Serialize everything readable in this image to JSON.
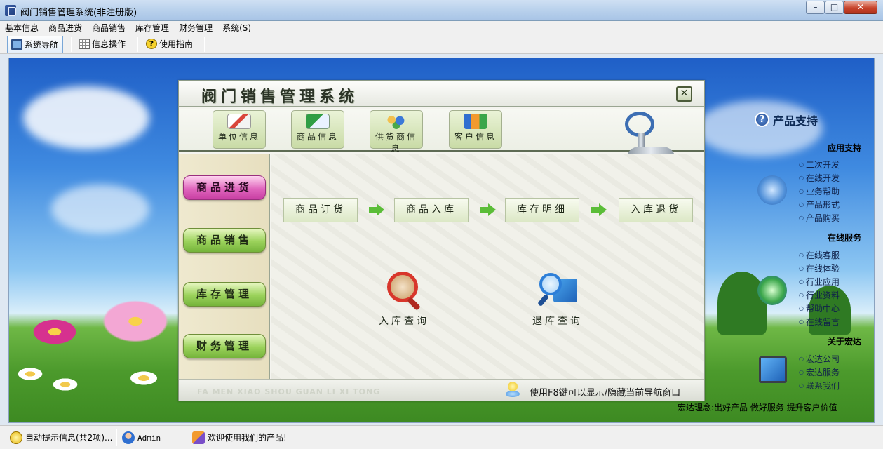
{
  "window": {
    "title": "阀门销售管理系统(非注册版)"
  },
  "menu": [
    "基本信息",
    "商品进货",
    "商品销售",
    "库存管理",
    "财务管理",
    "系统(S)"
  ],
  "toolbar": {
    "nav": "系统导航",
    "info": "信息操作",
    "guide": "使用指南"
  },
  "navigator": {
    "title": "阀门销售管理系统",
    "close": "✕",
    "tools": [
      "单位信息",
      "商品信息",
      "供货商信息",
      "客户信息"
    ],
    "side": [
      "商品进货",
      "商品销售",
      "库存管理",
      "财务管理"
    ],
    "active_side": "商品进货",
    "flow": [
      "商品订货",
      "商品入库",
      "库存明细",
      "入库退货"
    ],
    "queries": [
      "入库查询",
      "退库查询"
    ],
    "footer_pinyin": "FA MEN XIAO SHOU GUAN LI XI TONG",
    "footer_tip": "使用F8键可以显示/隐藏当前导航窗口"
  },
  "support": {
    "title": "产品支持",
    "sections": [
      {
        "name": "应用支持",
        "links": [
          "二次开发",
          "在线开发",
          "业务帮助",
          "产品形式",
          "产品购买"
        ]
      },
      {
        "name": "在线服务",
        "links": [
          "在线客服",
          "在线体验",
          "行业应用",
          "行业资料",
          "帮助中心",
          "在线留言"
        ]
      },
      {
        "name": "关于宏达",
        "links": [
          "宏达公司",
          "宏达服务",
          "联系我们"
        ]
      }
    ],
    "slogan": "宏达理念:出好产品 做好服务 提升客户价值"
  },
  "status": {
    "hint": "自动提示信息(共2项)...",
    "user": "Admin",
    "welcome": "欢迎使用我们的产品!"
  }
}
